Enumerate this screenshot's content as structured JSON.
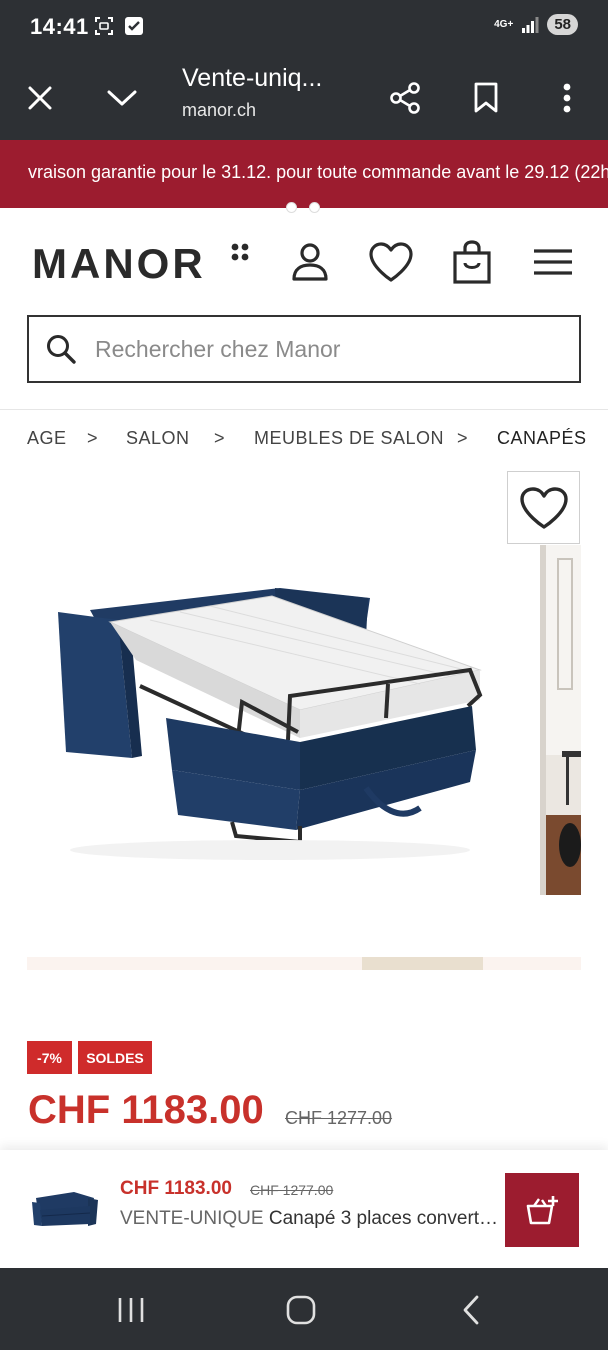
{
  "status_bar": {
    "time": "14:41",
    "network": "4G+",
    "battery": "58"
  },
  "browser": {
    "title": "Vente-uniq...",
    "domain": "manor.ch",
    "icons": [
      "close-icon",
      "chevron-down-icon",
      "share-icon",
      "bookmark-icon",
      "more-vert-icon"
    ]
  },
  "promo": {
    "text": "vraison garantie pour le 31.12. pour toute commande avant le 29.12 (22h)"
  },
  "header": {
    "logo": "MANOR",
    "icons": [
      "user-icon",
      "heart-icon",
      "shopping-bag-icon",
      "menu-icon"
    ]
  },
  "search": {
    "placeholder": "Rechercher chez Manor"
  },
  "breadcrumb": {
    "items": [
      "AGE",
      "SALON",
      "MEUBLES DE SALON",
      "CANAPÉS"
    ],
    "separator": ">"
  },
  "product": {
    "badge_discount": "-7%",
    "badge_sale": "SOLDES",
    "price": "CHF 1183.00",
    "old_price": "CHF 1277.00"
  },
  "sticky": {
    "price": "CHF 1183.00",
    "old_price": "CHF 1277.00",
    "brand": "VENTE-UNIQUE",
    "name": "Canapé 3 places convertible"
  },
  "colors": {
    "accent": "#9c1c2f",
    "price": "#c8312b",
    "badge": "#cf2b2b",
    "sofa": "#1f3a63"
  }
}
